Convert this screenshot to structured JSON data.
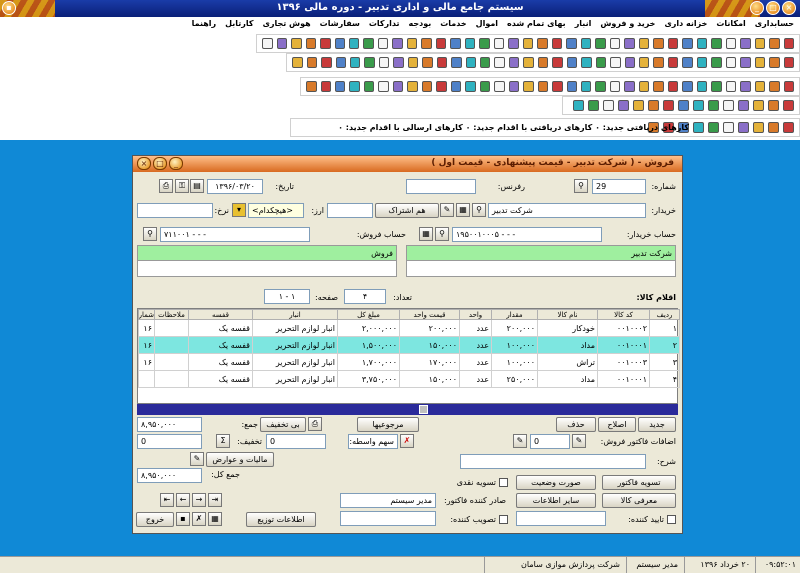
{
  "app": {
    "title": "سیستم جامع مالی و اداری تدبیر - دوره مالی ۱۳۹۶"
  },
  "menu": [
    "حسابداری",
    "امکانات",
    "خزانه داری",
    "خرید و فروش",
    "انبار",
    "بهای تمام شده",
    "اموال",
    "خدمات",
    "بودجه",
    "تدارکات",
    "سفارشات",
    "هوش تجاری",
    "کارتابل",
    "راهنما"
  ],
  "notice": "کارهای دریافتی جدید: ۰ کارهای دریافتی با اقدام جدید: ۰ کارهای ارسالی با اقدام جدید: ۰",
  "dialog": {
    "title": "فروش - ( شرکت تدبیر - قیمت پیشنهادی - قیمت اول )",
    "labels": {
      "number": "شماره:",
      "date": "تاریخ:",
      "reference": "رفرنس:",
      "buyer": "خریدار:",
      "currency": "ارز:",
      "rate": "نرخ:",
      "buyer_account": "حساب خریدار:",
      "seller_account": "حساب فروش:",
      "items": "اقلام کالا:",
      "count": "تعداد:",
      "page": "صفحه:",
      "total": "جمع:",
      "discount": "تخفیف:",
      "net": "جمع کل:",
      "additions": "اضافات فاکتور فروش:",
      "desc": "شرح:",
      "broker": "سهم واسطه:",
      "issuer": "صادر کننده فاکتور:",
      "approver": "تصویب کننده:",
      "confirmer": "تایید کننده:",
      "cash_settle": "تسویه نقدی",
      "approve": "تصویب"
    },
    "values": {
      "number": "29",
      "date": "۱۳۹۶/۰۳/۲۰",
      "reference": "",
      "buyer": "شرکت تدبیر",
      "currency": "<هیچکدام>",
      "rate": "",
      "buyer_account": "۱۹۵۰۰۱۰۰۰۵ - - -",
      "seller_account": "۷۱۱۰۰۱ - - -",
      "count": "۴",
      "page": "۱ - ۱",
      "total": "۸,۹۵۰,۰۰۰",
      "discount_type": "0",
      "discount": "0",
      "net": "۸,۹۵۰,۰۰۰",
      "additions": "0",
      "issuer": "مدیر سیستم",
      "broker": ""
    },
    "buttons": {
      "same_company": "هم اشتراک",
      "discount_no": "بی تخفیف",
      "returns": "مرجوعیها",
      "new": "جدید",
      "edit": "اصلاح",
      "delete": "حذف",
      "taxes": "مالیات و عوارض",
      "print_invoice": "تسویه فاکتور",
      "status": "صورت وضعیت",
      "item_info": "معرفی کالا",
      "other_info": "سایر اطلاعات",
      "distribute": "اطلاعات توزیع",
      "exit": "خروج"
    },
    "buyer_panel": {
      "header": "شرکت تدبیر"
    },
    "seller_panel": {
      "header": "فروش"
    }
  },
  "table": {
    "columns": [
      "ردیف",
      "کد کالا",
      "نام کالا",
      "مقدار",
      "واحد",
      "قیمت واحد",
      "مبلغ کل",
      "انبار",
      "قفسه",
      "ملاحظات",
      "شماره س"
    ],
    "rows": [
      {
        "row": "۱",
        "code": "۰۰۱۰۰۰۲",
        "name": "خودکار",
        "qty": "۲۰۰,۰۰۰",
        "unit": "عدد",
        "price": "۲۰۰,۰۰۰",
        "amount": "۲,۰۰۰,۰۰۰",
        "store": "انبار لوازم التحریر",
        "shelf": "قفسه یک",
        "note": "",
        "serial": "۱۶"
      },
      {
        "row": "۲",
        "code": "۰۰۱۰۰۰۱",
        "name": "مداد",
        "qty": "۱۰۰,۰۰۰",
        "unit": "عدد",
        "price": "۱۵۰,۰۰۰",
        "amount": "۱,۵۰۰,۰۰۰",
        "store": "انبار لوازم التحریر",
        "shelf": "قفسه یک",
        "note": "",
        "serial": "۱۶"
      },
      {
        "row": "۳",
        "code": "۰۰۱۰۰۰۳",
        "name": "تراش",
        "qty": "۱۰۰,۰۰۰",
        "unit": "عدد",
        "price": "۱۷۰,۰۰۰",
        "amount": "۱,۷۰۰,۰۰۰",
        "store": "انبار لوازم التحریر",
        "shelf": "قفسه یک",
        "note": "",
        "serial": "۱۶"
      },
      {
        "row": "۴",
        "code": "۰۰۱۰۰۰۱",
        "name": "مداد",
        "qty": "۲۵۰,۰۰۰",
        "unit": "عدد",
        "price": "۱۵۰,۰۰۰",
        "amount": "۳,۷۵۰,۰۰۰",
        "store": "انبار لوازم التحریر",
        "shelf": "قفسه یک",
        "note": "",
        "serial": ""
      }
    ]
  },
  "status": {
    "time": "۰۹:۵۲:۰۱",
    "date": "۲۰ خرداد ۱۳۹۶",
    "user": "مدیر سیستم",
    "company": "شرکت پردازش موازی سامان"
  }
}
